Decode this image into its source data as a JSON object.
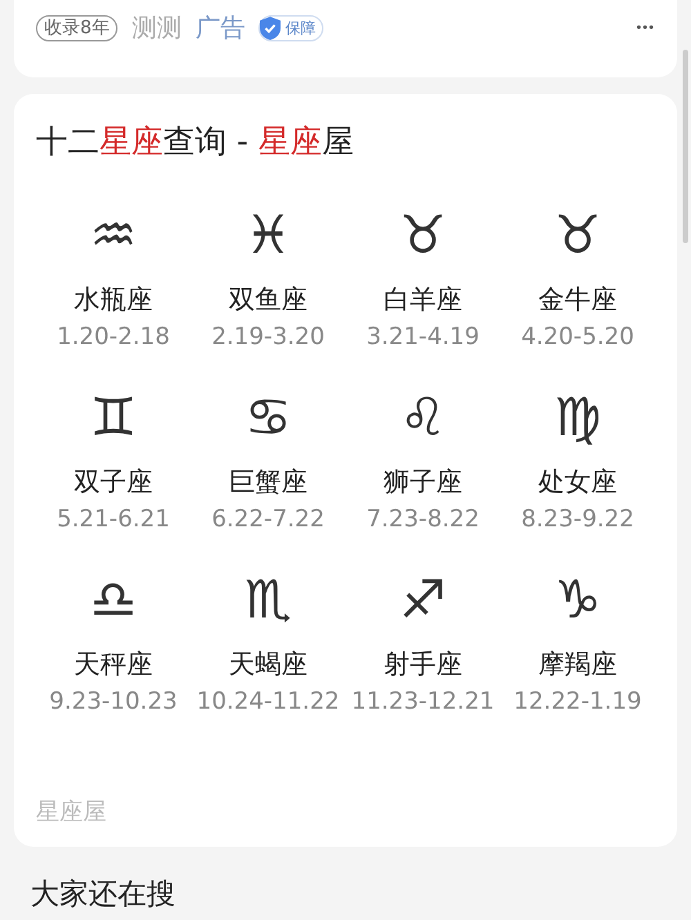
{
  "top_card": {
    "badge": "收录8年",
    "author": "测测",
    "ad_label": "广告",
    "guarantee": "保障",
    "more": "•••"
  },
  "zodiac_card": {
    "title": [
      {
        "text": "十二",
        "highlight": false
      },
      {
        "text": "星座",
        "highlight": true
      },
      {
        "text": "查询 - ",
        "highlight": false
      },
      {
        "text": "星座",
        "highlight": true
      },
      {
        "text": "屋",
        "highlight": false
      }
    ],
    "signs": [
      {
        "symbol": "♒",
        "name": "水瓶座",
        "dates": "1.20-2.18"
      },
      {
        "symbol": "♓",
        "name": "双鱼座",
        "dates": "2.19-3.20"
      },
      {
        "symbol": "♉",
        "name": "白羊座",
        "dates": "3.21-4.19"
      },
      {
        "symbol": "♉",
        "name": "金牛座",
        "dates": "4.20-5.20"
      },
      {
        "symbol": "♊",
        "name": "双子座",
        "dates": "5.21-6.21"
      },
      {
        "symbol": "♋",
        "name": "巨蟹座",
        "dates": "6.22-7.22"
      },
      {
        "symbol": "♌",
        "name": "狮子座",
        "dates": "7.23-8.22"
      },
      {
        "symbol": "♍",
        "name": "处女座",
        "dates": "8.23-9.22"
      },
      {
        "symbol": "♎",
        "name": "天秤座",
        "dates": "9.23-10.23"
      },
      {
        "symbol": "♏",
        "name": "天蝎座",
        "dates": "10.24-11.22"
      },
      {
        "symbol": "♐",
        "name": "射手座",
        "dates": "11.23-12.21"
      },
      {
        "symbol": "♑",
        "name": "摩羯座",
        "dates": "12.22-1.19"
      }
    ],
    "source": "星座屋"
  },
  "related_heading": "大家还在搜"
}
